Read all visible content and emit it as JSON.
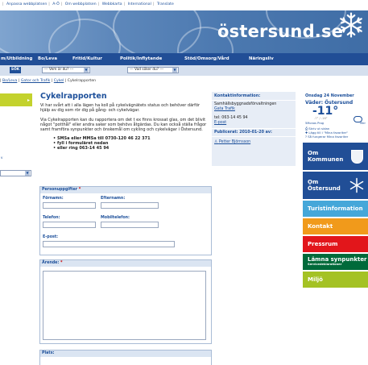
{
  "topnav": {
    "items": [
      "Anpassa webbplatsen",
      "A-Ö",
      "Om webbplatsen",
      "Webbkarta",
      "International",
      "Translate"
    ]
  },
  "banner": {
    "logo": "östersund.se"
  },
  "mainnav": {
    "items": [
      "m/Utbildning",
      "Bo/Leva",
      "Fritid/Kultur",
      "Politik/Inflytande",
      "Stöd/Omsorg/Vård",
      "Näringsliv"
    ]
  },
  "toolbar": {
    "search_button": "SÖK",
    "select_who": "--- Vem är du? ---",
    "select_what": "--- Vad söker du? ---"
  },
  "breadcrumb": {
    "items": [
      "Bo/Leva",
      "Gator och Trafik",
      "Cykel"
    ],
    "current": "Cykelrapporten"
  },
  "article": {
    "title": "Cykelrapporten",
    "paragraph1": "Vi har svårt att i alla lägen ha koll på cykelvägnätets status och behöver därför hjälp av dig som rör dig på gång- och cykelvägar.",
    "paragraph2": "Via Cykelrapporten kan du rapportera om det t ex finns krossat glas, om det blivit något \"potthål\" eller andra saker som behövs åtgärdas. Du kan också ställa frågor samt framföra synpunkter och önskemål om cykling och cykelvägar i Östersund.",
    "bullets": [
      "SMSa eller MMSa till 0730-120 46 22 371",
      "fyll i formuläret nedan",
      "eller ring 063-14 45 94"
    ]
  },
  "form": {
    "personal_heading": "Personuppgifter",
    "required_mark": "*",
    "firstname_label": "Förnamn:",
    "lastname_label": "Efternamn:",
    "phone_label": "Telefon:",
    "mobile_label": "Mobiltelefon:",
    "email_label": "E-post:",
    "errand_heading": "Ärende:",
    "place_heading": "Plats:"
  },
  "contact": {
    "title": "Kontaktinformation:",
    "org": "Samhällsbyggnadsförvaltningen",
    "dept": "Gata Trafik",
    "phone": "tel: 063-14 45 94",
    "email": "E-post",
    "published": "Publicerat: 2010-01-20 av:",
    "person": "Petter Björnsson"
  },
  "sidebar": {
    "date": "Onsdag 24 November",
    "weather_title": "Väder: Östersund",
    "temp": "-11°",
    "temp_sub": "-7° / -16°",
    "weather_link": "5Monos Prog",
    "weather_more": "Mer",
    "tool1": "Skriv ut sidan",
    "tool2": "Lägg till i \"Mina favoriter\"",
    "tool3": "Så fungerar Mina favoriter",
    "buttons": {
      "kommunen": [
        "Om",
        "Kommunen"
      ],
      "ostersund": [
        "Om",
        "Östersund"
      ],
      "turist": "Turistinformation",
      "kontakt": "Kontakt",
      "pressrum": "Pressrum",
      "synpunkter": "Lämna synpunkter",
      "synpunkter_sub": "Servicedeklarationer",
      "miljo": "Miljö"
    }
  },
  "colors": {
    "navy": "#214e96",
    "lime": "#c3d22d",
    "orange": "#f19a1b",
    "red": "#e2161b",
    "green": "#006a3a",
    "sky": "#45a7d9",
    "olive": "#a4c224"
  }
}
